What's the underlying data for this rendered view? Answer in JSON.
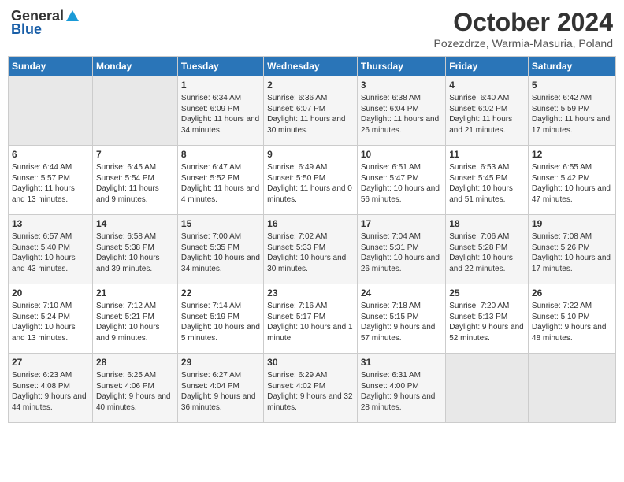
{
  "header": {
    "logo_general": "General",
    "logo_blue": "Blue",
    "month_title": "October 2024",
    "location": "Pozezdrze, Warmia-Masuria, Poland"
  },
  "days_of_week": [
    "Sunday",
    "Monday",
    "Tuesday",
    "Wednesday",
    "Thursday",
    "Friday",
    "Saturday"
  ],
  "weeks": [
    [
      {
        "day": "",
        "sunrise": "",
        "sunset": "",
        "daylight": ""
      },
      {
        "day": "",
        "sunrise": "",
        "sunset": "",
        "daylight": ""
      },
      {
        "day": "1",
        "sunrise": "Sunrise: 6:34 AM",
        "sunset": "Sunset: 6:09 PM",
        "daylight": "Daylight: 11 hours and 34 minutes."
      },
      {
        "day": "2",
        "sunrise": "Sunrise: 6:36 AM",
        "sunset": "Sunset: 6:07 PM",
        "daylight": "Daylight: 11 hours and 30 minutes."
      },
      {
        "day": "3",
        "sunrise": "Sunrise: 6:38 AM",
        "sunset": "Sunset: 6:04 PM",
        "daylight": "Daylight: 11 hours and 26 minutes."
      },
      {
        "day": "4",
        "sunrise": "Sunrise: 6:40 AM",
        "sunset": "Sunset: 6:02 PM",
        "daylight": "Daylight: 11 hours and 21 minutes."
      },
      {
        "day": "5",
        "sunrise": "Sunrise: 6:42 AM",
        "sunset": "Sunset: 5:59 PM",
        "daylight": "Daylight: 11 hours and 17 minutes."
      }
    ],
    [
      {
        "day": "6",
        "sunrise": "Sunrise: 6:44 AM",
        "sunset": "Sunset: 5:57 PM",
        "daylight": "Daylight: 11 hours and 13 minutes."
      },
      {
        "day": "7",
        "sunrise": "Sunrise: 6:45 AM",
        "sunset": "Sunset: 5:54 PM",
        "daylight": "Daylight: 11 hours and 9 minutes."
      },
      {
        "day": "8",
        "sunrise": "Sunrise: 6:47 AM",
        "sunset": "Sunset: 5:52 PM",
        "daylight": "Daylight: 11 hours and 4 minutes."
      },
      {
        "day": "9",
        "sunrise": "Sunrise: 6:49 AM",
        "sunset": "Sunset: 5:50 PM",
        "daylight": "Daylight: 11 hours and 0 minutes."
      },
      {
        "day": "10",
        "sunrise": "Sunrise: 6:51 AM",
        "sunset": "Sunset: 5:47 PM",
        "daylight": "Daylight: 10 hours and 56 minutes."
      },
      {
        "day": "11",
        "sunrise": "Sunrise: 6:53 AM",
        "sunset": "Sunset: 5:45 PM",
        "daylight": "Daylight: 10 hours and 51 minutes."
      },
      {
        "day": "12",
        "sunrise": "Sunrise: 6:55 AM",
        "sunset": "Sunset: 5:42 PM",
        "daylight": "Daylight: 10 hours and 47 minutes."
      }
    ],
    [
      {
        "day": "13",
        "sunrise": "Sunrise: 6:57 AM",
        "sunset": "Sunset: 5:40 PM",
        "daylight": "Daylight: 10 hours and 43 minutes."
      },
      {
        "day": "14",
        "sunrise": "Sunrise: 6:58 AM",
        "sunset": "Sunset: 5:38 PM",
        "daylight": "Daylight: 10 hours and 39 minutes."
      },
      {
        "day": "15",
        "sunrise": "Sunrise: 7:00 AM",
        "sunset": "Sunset: 5:35 PM",
        "daylight": "Daylight: 10 hours and 34 minutes."
      },
      {
        "day": "16",
        "sunrise": "Sunrise: 7:02 AM",
        "sunset": "Sunset: 5:33 PM",
        "daylight": "Daylight: 10 hours and 30 minutes."
      },
      {
        "day": "17",
        "sunrise": "Sunrise: 7:04 AM",
        "sunset": "Sunset: 5:31 PM",
        "daylight": "Daylight: 10 hours and 26 minutes."
      },
      {
        "day": "18",
        "sunrise": "Sunrise: 7:06 AM",
        "sunset": "Sunset: 5:28 PM",
        "daylight": "Daylight: 10 hours and 22 minutes."
      },
      {
        "day": "19",
        "sunrise": "Sunrise: 7:08 AM",
        "sunset": "Sunset: 5:26 PM",
        "daylight": "Daylight: 10 hours and 17 minutes."
      }
    ],
    [
      {
        "day": "20",
        "sunrise": "Sunrise: 7:10 AM",
        "sunset": "Sunset: 5:24 PM",
        "daylight": "Daylight: 10 hours and 13 minutes."
      },
      {
        "day": "21",
        "sunrise": "Sunrise: 7:12 AM",
        "sunset": "Sunset: 5:21 PM",
        "daylight": "Daylight: 10 hours and 9 minutes."
      },
      {
        "day": "22",
        "sunrise": "Sunrise: 7:14 AM",
        "sunset": "Sunset: 5:19 PM",
        "daylight": "Daylight: 10 hours and 5 minutes."
      },
      {
        "day": "23",
        "sunrise": "Sunrise: 7:16 AM",
        "sunset": "Sunset: 5:17 PM",
        "daylight": "Daylight: 10 hours and 1 minute."
      },
      {
        "day": "24",
        "sunrise": "Sunrise: 7:18 AM",
        "sunset": "Sunset: 5:15 PM",
        "daylight": "Daylight: 9 hours and 57 minutes."
      },
      {
        "day": "25",
        "sunrise": "Sunrise: 7:20 AM",
        "sunset": "Sunset: 5:13 PM",
        "daylight": "Daylight: 9 hours and 52 minutes."
      },
      {
        "day": "26",
        "sunrise": "Sunrise: 7:22 AM",
        "sunset": "Sunset: 5:10 PM",
        "daylight": "Daylight: 9 hours and 48 minutes."
      }
    ],
    [
      {
        "day": "27",
        "sunrise": "Sunrise: 6:23 AM",
        "sunset": "Sunset: 4:08 PM",
        "daylight": "Daylight: 9 hours and 44 minutes."
      },
      {
        "day": "28",
        "sunrise": "Sunrise: 6:25 AM",
        "sunset": "Sunset: 4:06 PM",
        "daylight": "Daylight: 9 hours and 40 minutes."
      },
      {
        "day": "29",
        "sunrise": "Sunrise: 6:27 AM",
        "sunset": "Sunset: 4:04 PM",
        "daylight": "Daylight: 9 hours and 36 minutes."
      },
      {
        "day": "30",
        "sunrise": "Sunrise: 6:29 AM",
        "sunset": "Sunset: 4:02 PM",
        "daylight": "Daylight: 9 hours and 32 minutes."
      },
      {
        "day": "31",
        "sunrise": "Sunrise: 6:31 AM",
        "sunset": "Sunset: 4:00 PM",
        "daylight": "Daylight: 9 hours and 28 minutes."
      },
      {
        "day": "",
        "sunrise": "",
        "sunset": "",
        "daylight": ""
      },
      {
        "day": "",
        "sunrise": "",
        "sunset": "",
        "daylight": ""
      }
    ]
  ]
}
